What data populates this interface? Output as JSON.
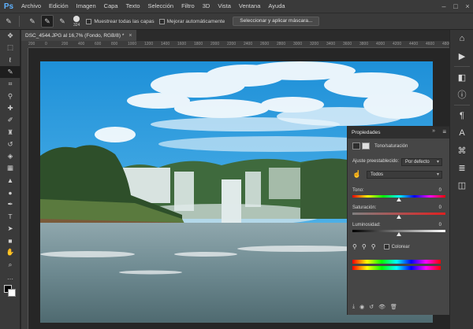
{
  "app": {
    "logo": "Ps"
  },
  "menu": [
    "Archivo",
    "Edición",
    "Imagen",
    "Capa",
    "Texto",
    "Selección",
    "Filtro",
    "3D",
    "Vista",
    "Ventana",
    "Ayuda"
  ],
  "options": {
    "brush_size": "324",
    "sample_all_layers": "Muestrear todas las capas",
    "auto_enhance": "Mejorar automáticamente",
    "select_mask_button": "Seleccionar y aplicar máscara..."
  },
  "document": {
    "tab_title": "DSC_4544.JPG al 16,7% (Fondo, RGB/8) *",
    "close": "×"
  },
  "ruler": {
    "ticks": [
      "200",
      "0",
      "200",
      "400",
      "600",
      "800",
      "1000",
      "1200",
      "1400",
      "1600",
      "1800",
      "2000",
      "2200",
      "2400",
      "2600",
      "2800",
      "3000",
      "3200",
      "3400",
      "3600",
      "3800",
      "4000",
      "4200",
      "4400",
      "4600",
      "4800"
    ]
  },
  "properties": {
    "panel_title": "Propiedades",
    "adjustment_name": "Tono/saturación",
    "preset_label": "Ajuste preestablecido:",
    "preset_value": "Por defecto",
    "channel_value": "Todos",
    "hue_label": "Tono:",
    "hue_value": "0",
    "saturation_label": "Saturación:",
    "saturation_value": "0",
    "lightness_label": "Luminosidad:",
    "lightness_value": "0",
    "colorize_label": "Colorear"
  },
  "colors": {
    "ui_dark": "#282828",
    "panel": "#3a3a3a",
    "accent": "#5fb2ff"
  }
}
